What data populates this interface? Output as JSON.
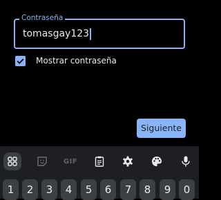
{
  "form": {
    "password_label": "Contraseña",
    "password_value": "tomasgay123",
    "show_password_label": "Mostrar contraseña",
    "show_password_checked": true,
    "next_label": "Siguiente"
  },
  "keyboard": {
    "toolbar": {
      "apps_icon": "grid-icon",
      "sticker_icon": "sticker-icon",
      "gif_label": "GIF",
      "clipboard_icon": "clipboard-icon",
      "settings_icon": "gear-icon",
      "theme_icon": "palette-icon",
      "voice_icon": "microphone-icon"
    },
    "number_keys": [
      "1",
      "2",
      "3",
      "4",
      "5",
      "6",
      "7",
      "8",
      "9",
      "0"
    ]
  },
  "colors": {
    "accent": "#8ab4f8",
    "background": "#000000",
    "keyboard_bg": "#1e1f22",
    "key_bg": "#3c4043",
    "text": "#e8eaed"
  }
}
